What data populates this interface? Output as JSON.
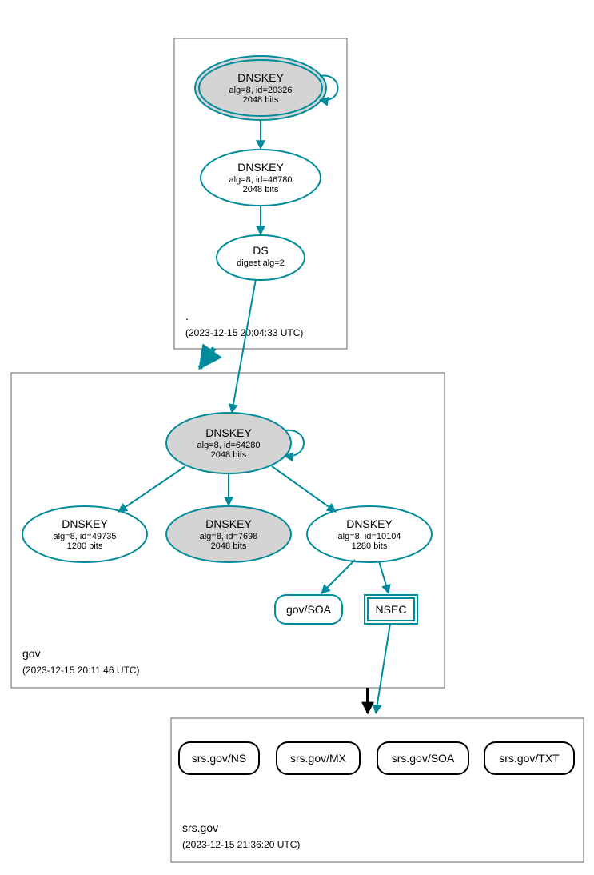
{
  "colors": {
    "teal": "#008B9C",
    "nodeGray": "#d4d4d4"
  },
  "zones": {
    "root": {
      "label": ".",
      "timestamp": "(2023-12-15 20:04:33 UTC)",
      "nodes": {
        "key1": {
          "title": "DNSKEY",
          "line2": "alg=8, id=20326",
          "line3": "2048 bits"
        },
        "key2": {
          "title": "DNSKEY",
          "line2": "alg=8, id=46780",
          "line3": "2048 bits"
        },
        "ds": {
          "title": "DS",
          "line2": "digest alg=2"
        }
      }
    },
    "gov": {
      "label": "gov",
      "timestamp": "(2023-12-15 20:11:46 UTC)",
      "nodes": {
        "ksk": {
          "title": "DNSKEY",
          "line2": "alg=8, id=64280",
          "line3": "2048 bits"
        },
        "zsk1": {
          "title": "DNSKEY",
          "line2": "alg=8, id=49735",
          "line3": "1280 bits"
        },
        "zsk2": {
          "title": "DNSKEY",
          "line2": "alg=8, id=7698",
          "line3": "2048 bits"
        },
        "zsk3": {
          "title": "DNSKEY",
          "line2": "alg=8, id=10104",
          "line3": "1280 bits"
        },
        "soa": {
          "title": "gov/SOA"
        },
        "nsec": {
          "title": "NSEC"
        }
      }
    },
    "srs": {
      "label": "srs.gov",
      "timestamp": "(2023-12-15 21:36:20 UTC)",
      "nodes": {
        "ns": {
          "title": "srs.gov/NS"
        },
        "mx": {
          "title": "srs.gov/MX"
        },
        "soa": {
          "title": "srs.gov/SOA"
        },
        "txt": {
          "title": "srs.gov/TXT"
        }
      }
    }
  }
}
